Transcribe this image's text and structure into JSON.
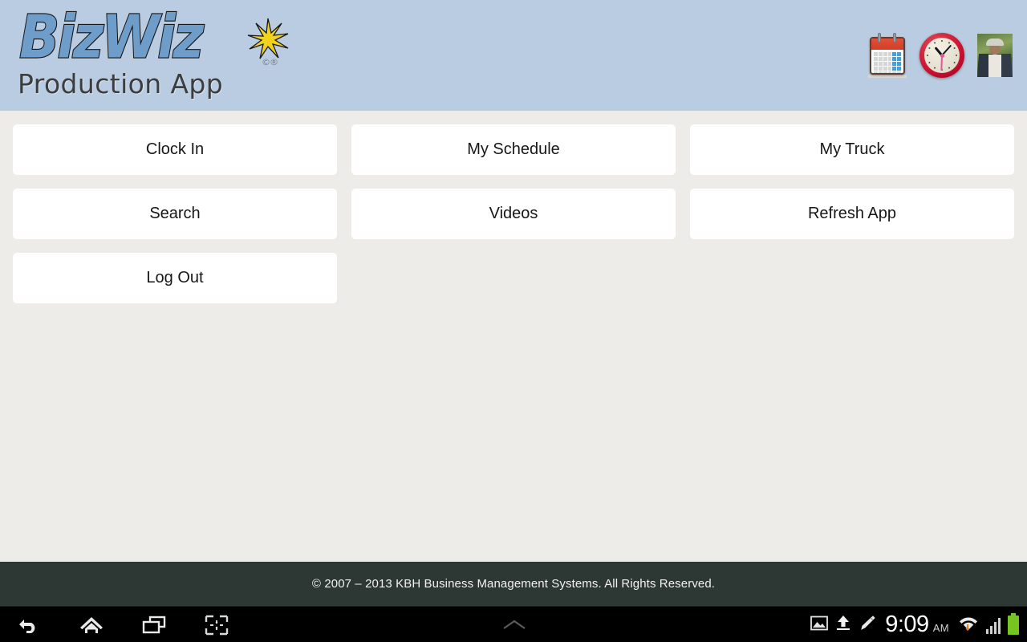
{
  "header": {
    "logo": {
      "wordmark": "BizWiz",
      "registered_mark": "©®",
      "subtitle": "Production App",
      "star_icon": "starburst-icon",
      "brand_blue": "#6e9dc9",
      "star_yellow": "#f2d21a",
      "band_color": "#b9cce1"
    },
    "icons": [
      {
        "name": "calendar-icon",
        "label": "Calendar"
      },
      {
        "name": "clock-icon",
        "label": "Clock"
      },
      {
        "name": "avatar-icon",
        "label": "User Profile"
      }
    ]
  },
  "main": {
    "buttons": [
      {
        "label": "Clock In"
      },
      {
        "label": "My Schedule"
      },
      {
        "label": "My Truck"
      },
      {
        "label": "Search"
      },
      {
        "label": "Videos"
      },
      {
        "label": "Refresh App"
      },
      {
        "label": "Log Out"
      }
    ],
    "tile_bg": "#ffffff",
    "page_bg": "#edece8"
  },
  "footer": {
    "copyright": "© 2007 – 2013 KBH Business Management Systems. All Rights Reserved.",
    "bg": "#2d3733"
  },
  "system_bar": {
    "nav": [
      {
        "name": "back-icon",
        "label": "Back"
      },
      {
        "name": "home-icon",
        "label": "Home"
      },
      {
        "name": "recents-icon",
        "label": "Recent apps"
      },
      {
        "name": "screenshot-icon",
        "label": "Screenshot"
      }
    ],
    "center": {
      "name": "chevron-up-icon",
      "label": "Show navigation bar"
    },
    "status": {
      "image_icon": "image-icon",
      "upload_icon": "upload-icon",
      "edit_icon": "pencil-icon",
      "time": "9:09",
      "meridiem": "AM",
      "wifi_icon": "wifi-data-icon",
      "signal_icon": "signal-bars-icon",
      "battery_icon": "battery-icon",
      "battery_color": "#76c520",
      "data_arrow_color": "#e8820c"
    }
  }
}
